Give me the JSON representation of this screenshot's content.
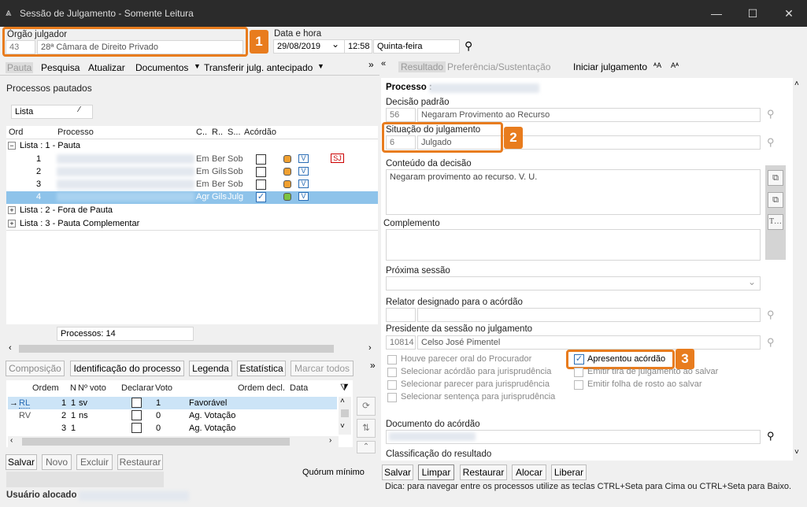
{
  "window": {
    "title": "Sessão de Julgamento - Somente Leitura"
  },
  "orgao": {
    "label": "Órgão julgador",
    "code": "43",
    "name": "28ª Câmara de Direito Privado"
  },
  "datahora": {
    "label": "Data e hora",
    "date": "29/08/2019",
    "time": "12:58",
    "weekday": "Quinta-feira"
  },
  "callouts": {
    "c1": "1",
    "c2": "2",
    "c3": "3"
  },
  "left_toolbar": {
    "pauta": "Pauta",
    "pesquisa": "Pesquisa",
    "atualizar": "Atualizar",
    "documentos": "Documentos",
    "transferir": "Transferir julg. antecipado"
  },
  "right_toolbar": {
    "resultado": "Resultado",
    "preferencia": "Preferência/Sustentação",
    "iniciar": "Iniciar julgamento"
  },
  "processos": {
    "section_label": "Processos pautados",
    "view_select": "Lista",
    "columns": {
      "ord": "Ord",
      "processo": "Processo",
      "c": "C..",
      "r": "R..",
      "s": "S...",
      "acordao": "Acórdão"
    },
    "groups": [
      {
        "label": "Lista : 1 - Pauta"
      },
      {
        "label": "Lista : 2 - Fora de Pauta"
      },
      {
        "label": "Lista : 3 - Pauta Complementar"
      }
    ],
    "rows": [
      {
        "ord": "1",
        "c": "Em",
        "r": "Ber",
        "s": "Sob",
        "checked": false,
        "status": "orange",
        "v": "V",
        "extra": "SJ"
      },
      {
        "ord": "2",
        "c": "Em",
        "r": "Gils",
        "s": "Sob",
        "checked": false,
        "status": "orange",
        "v": "V",
        "extra": ""
      },
      {
        "ord": "3",
        "c": "Em",
        "r": "Ber",
        "s": "Sob",
        "checked": false,
        "status": "orange",
        "v": "V",
        "extra": ""
      },
      {
        "ord": "4",
        "c": "Agr",
        "r": "Gils",
        "s": "Julg",
        "checked": true,
        "status": "green",
        "v": "V",
        "extra": ""
      }
    ],
    "count_label": "Processos: 14"
  },
  "bottom_tabs": {
    "composicao": "Composição",
    "identificacao": "Identificação do processo",
    "legenda": "Legenda",
    "estatistica": "Estatística",
    "marcar": "Marcar todos"
  },
  "votos": {
    "columns": {
      "ordem": "Ordem",
      "n": "N",
      "nvoto": "Nº voto",
      "declarar": "Declarar",
      "voto": "Voto",
      "ordem_decl": "Ordem decl.",
      "data": "Data"
    },
    "rows": [
      {
        "marker": "→",
        "role": "RL",
        "ordem": "1",
        "n": "1",
        "nv": "sv",
        "decl": false,
        "voto": "1",
        "desc": "Favorável"
      },
      {
        "marker": "",
        "role": "RV",
        "ordem": "2",
        "n": "1",
        "nv": "ns",
        "decl": false,
        "voto": "0",
        "desc": "Ag. Votação"
      },
      {
        "marker": "",
        "role": "",
        "ordem": "3",
        "n": "1",
        "nv": "",
        "decl": false,
        "voto": "0",
        "desc": "Ag. Votação"
      }
    ]
  },
  "left_buttons": {
    "salvar": "Salvar",
    "novo": "Novo",
    "excluir": "Excluir",
    "restaurar": "Restaurar"
  },
  "quorum": "Quórum mínimo",
  "usuario": "Usuário alocado",
  "right_form": {
    "processo_label": "Processo :",
    "decisao_label": "Decisão padrão",
    "decisao_code": "56",
    "decisao_text": "Negaram Provimento ao Recurso",
    "situacao_label": "Situação do julgamento",
    "situacao_code": "6",
    "situacao_text": "Julgado",
    "conteudo_label": "Conteúdo da decisão",
    "conteudo_text": "Negaram provimento ao recurso. V. U.",
    "complemento_label": "Complemento",
    "proxima_label": "Próxima sessão",
    "relator_label": "Relator designado para o acórdão",
    "presidente_label": "Presidente da sessão no julgamento",
    "presidente_code": "10814",
    "presidente_name": "Celso José Pimentel",
    "opts_left": [
      "Houve parecer oral do Procurador",
      "Selecionar acórdão para jurisprudência",
      "Selecionar parecer para jurisprudência",
      "Selecionar sentença para jurisprudência"
    ],
    "apresentou": "Apresentou acórdão",
    "opts_right": [
      "Emitir tira de julgamento ao salvar",
      "Emitir folha de rosto ao salvar"
    ],
    "documento_label": "Documento do acórdão",
    "classificacao_label": "Classificação do resultado"
  },
  "right_buttons": {
    "salvar": "Salvar",
    "limpar": "Limpar",
    "restaurar": "Restaurar",
    "alocar": "Alocar",
    "liberar": "Liberar"
  },
  "hint": "Dica: para navegar entre os processos utilize as teclas CTRL+Seta para Cima ou CTRL+Seta para Baixo.",
  "colors": {
    "accent": "#e87c1e",
    "selection": "#cce4f7",
    "titlebar": "#2b2b2b"
  }
}
